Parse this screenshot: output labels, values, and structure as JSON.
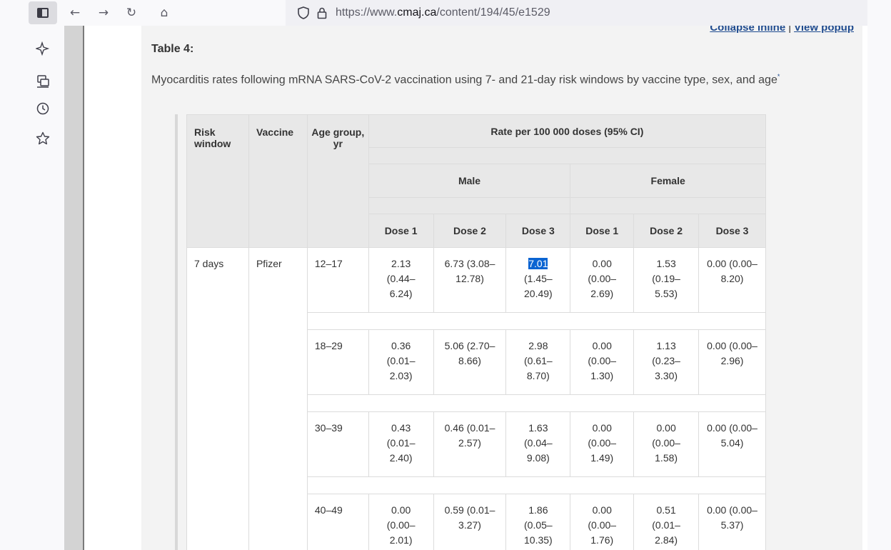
{
  "browser": {
    "url_prefix": "https://www.",
    "url_domain": "cmaj.ca",
    "url_path": "/content/194/45/e1529"
  },
  "icons": {
    "back": "arrow-left-icon",
    "forward": "arrow-right-icon",
    "reload": "reload-icon",
    "home": "home-icon",
    "shield": "shield-icon",
    "lock": "lock-icon",
    "sidebar": [
      "sparkle-icon",
      "synced-tabs-icon",
      "history-icon",
      "bookmark-star-icon"
    ]
  },
  "page": {
    "collapse_inline": "Collapse inline",
    "separator": "|",
    "view_popup": "View popup",
    "table_title": "Table 4:",
    "caption": "Myocarditis rates following mRNA SARS-CoV-2 vaccination using 7- and 21-day risk windows by vaccine type, sex, and age",
    "caption_marker": "*"
  },
  "table": {
    "col_risk_window": "Risk window",
    "col_vaccine": "Vaccine",
    "col_age_group": "Age group, yr",
    "col_rate": "Rate per 100 000 doses (95% CI)",
    "col_male": "Male",
    "col_female": "Female",
    "dose_headers": [
      "Dose 1",
      "Dose 2",
      "Dose 3",
      "Dose 1",
      "Dose 2",
      "Dose 3"
    ],
    "risk_window": "7 days",
    "vaccine": "Pfizer",
    "rows": [
      {
        "age": "12–17",
        "cells": [
          "2.13 (0.44–6.24)",
          "6.73 (3.08–12.78)",
          "(1.45–20.49)",
          "0.00 (0.00–2.69)",
          "1.53 (0.19–5.53)",
          "0.00 (0.00–8.20)"
        ],
        "selected": "7.01"
      },
      {
        "age": "18–29",
        "cells": [
          "0.36 (0.01–2.03)",
          "5.06 (2.70–8.66)",
          "2.98 (0.61–8.70)",
          "0.00 (0.00–1.30)",
          "1.13 (0.23–3.30)",
          "0.00 (0.00–2.96)"
        ]
      },
      {
        "age": "30–39",
        "cells": [
          "0.43 (0.01–2.40)",
          "0.46 (0.01–2.57)",
          "1.63 (0.04–9.08)",
          "0.00 (0.00–1.49)",
          "0.00 (0.00–1.58)",
          "0.00 (0.00–5.04)"
        ]
      },
      {
        "age": "40–49",
        "cells": [
          "0.00 (0.00–2.01)",
          "0.59 (0.01–3.27)",
          "1.86 (0.05–10.35)",
          "0.00 (0.00–1.76)",
          "0.51 (0.01–2.84)",
          "0.00 (0.00–5.37)"
        ]
      }
    ]
  }
}
